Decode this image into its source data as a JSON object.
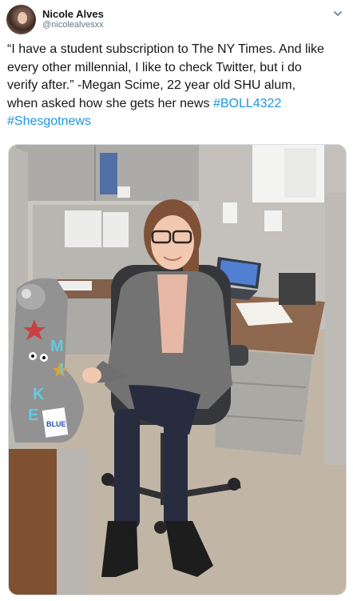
{
  "author": {
    "display_name": "Nicole Alves",
    "handle": "@nicolealvesxx"
  },
  "tweet": {
    "line1": "“I have a student subscription to The NY Times. And like",
    "line2": "every other millennial, I like to check Twitter, but i do",
    "line3_text": "verify after.” -Megan Scime, 22 year old SHU alum,",
    "line4_text": "when asked how she gets her news ",
    "hashtag1": "#BOLL4322",
    "hashtag2": "#Shesgotnews"
  },
  "media": {
    "stocking_letters": [
      "M",
      "I",
      "K",
      "E"
    ],
    "stocking_tag": "BLUE"
  },
  "colors": {
    "hashtag": "#1b95e0",
    "text": "#14171a",
    "secondary": "#657786"
  }
}
